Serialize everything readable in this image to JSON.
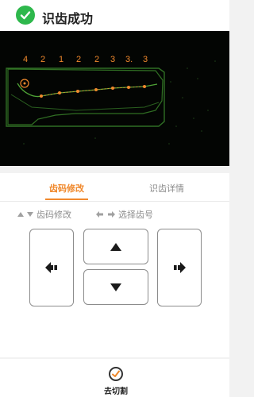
{
  "header": {
    "title": "识齿成功",
    "status_icon": "check-circle-icon",
    "status_color": "#2eb84c"
  },
  "scan": {
    "depth_codes": [
      "4",
      "2",
      "1",
      "2",
      "2",
      "3",
      "3.",
      "3"
    ],
    "marker_color": "#f0892d",
    "outline_color": "#3c8a2c"
  },
  "tabs": [
    {
      "label": "齿码修改",
      "active": true
    },
    {
      "label": "识齿详情",
      "active": false
    }
  ],
  "hints": {
    "modify_code": "齿码修改",
    "select_tooth": "选择齿号"
  },
  "controls": {
    "left_icon": "arrow-left-icon",
    "up_icon": "triangle-up-icon",
    "down_icon": "triangle-down-icon",
    "right_icon": "arrow-right-icon"
  },
  "footer": {
    "cut_label": "去切割",
    "cut_icon": "check-circle-icon",
    "accent_color": "#f0892d"
  }
}
